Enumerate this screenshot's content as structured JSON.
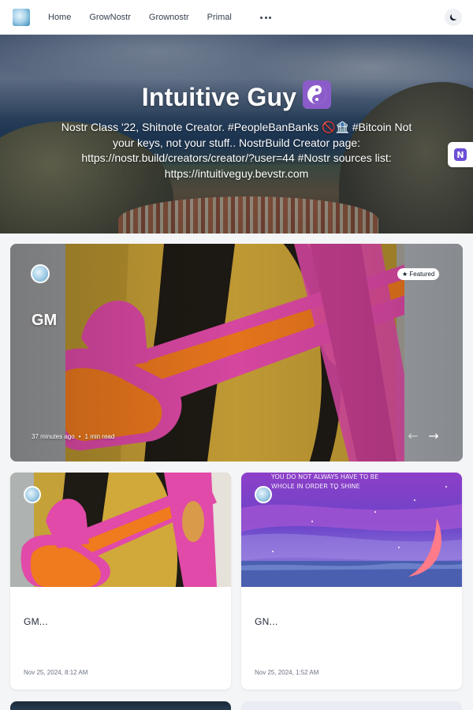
{
  "nav": {
    "links": [
      "Home",
      "GrowNostr",
      "Grownostr",
      "Primal"
    ],
    "more_icon": "more-horizontal-icon",
    "theme_icon": "moon-icon"
  },
  "hero": {
    "title": "Intuitive Guy",
    "title_icon": "yin-yang-icon",
    "bio": "Nostr Class '22, Shitnote Creator. #PeopleBanBanks 🚫🏦 #Bitcoin Not your keys, not your stuff.. NostrBuild Creator page: https://nostr.build/creators/creator/?user=44 #Nostr sources list: https://intuitiveguy.bevstr.com",
    "side_badge_icon": "nostr-icon",
    "side_badge_letter": "N"
  },
  "featured": {
    "badge": "★ Featured",
    "title": "GM",
    "time": "37 minutes ago",
    "separator": "•",
    "read_time": "1 min read",
    "prev_arrow": "←",
    "next_arrow": "→"
  },
  "cards": [
    {
      "title": "GM...",
      "date": "Nov 25, 2024, 8:12 AM"
    },
    {
      "title": "GN...",
      "date": "Nov 25, 2024, 1:52 AM",
      "image_text": "YOU DO NOT ALWAYS HAVE TO BE WHOLE IN ORDER TO SHINE"
    }
  ],
  "colors": {
    "accent": "#6d4fd6",
    "title_icon_bg": "#8b5cc9",
    "magenta": "#e83fae",
    "orange": "#f26522"
  }
}
